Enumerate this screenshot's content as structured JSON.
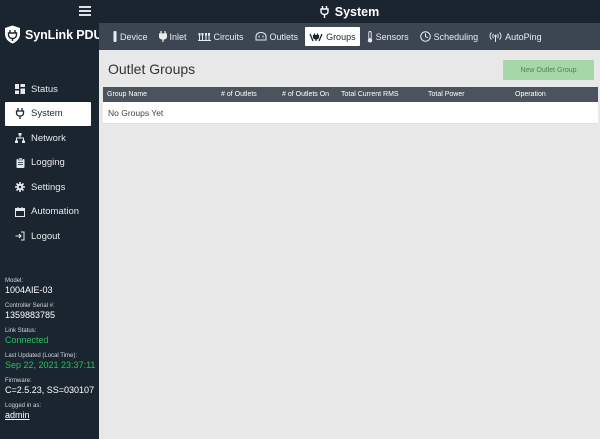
{
  "brand": {
    "name": "SynLink PDU"
  },
  "page": {
    "title": "System"
  },
  "sidebar": {
    "items": [
      {
        "label": "Status",
        "icon": "dashboard-icon"
      },
      {
        "label": "System",
        "icon": "plug-icon",
        "active": true
      },
      {
        "label": "Network",
        "icon": "network-icon"
      },
      {
        "label": "Logging",
        "icon": "clipboard-icon"
      },
      {
        "label": "Settings",
        "icon": "gear-icon"
      },
      {
        "label": "Automation",
        "icon": "calendar-icon"
      },
      {
        "label": "Logout",
        "icon": "logout-icon"
      }
    ]
  },
  "device_info": {
    "model_label": "Model:",
    "model": "1004AIE-03",
    "serial_label": "Controller Serial #:",
    "serial": "1359883785",
    "link_label": "Link Status:",
    "link": "Connected",
    "updated_label": "Last Updated (Local Time):",
    "updated": "Sep 22, 2021 23:37:11",
    "firmware_label": "Firmware:",
    "firmware": "C=2.5.23, SS=030107",
    "login_label": "Logged in as:",
    "user": "admin"
  },
  "tabs": [
    {
      "label": "Device",
      "icon": "device-icon"
    },
    {
      "label": "Inlet",
      "icon": "plug-icon"
    },
    {
      "label": "Circuits",
      "icon": "circuits-icon"
    },
    {
      "label": "Outlets",
      "icon": "outlet-icon"
    },
    {
      "label": "Groups",
      "icon": "groups-icon",
      "active": true
    },
    {
      "label": "Sensors",
      "icon": "thermometer-icon"
    },
    {
      "label": "Scheduling",
      "icon": "clock-icon"
    },
    {
      "label": "AutoPing",
      "icon": "broadcast-icon"
    }
  ],
  "content": {
    "heading": "Outlet Groups",
    "new_button": "New Outlet Group",
    "columns": [
      "Group Name",
      "# of Outlets",
      "# of Outlets On",
      "Total Current RMS",
      "Total Power",
      "Operation"
    ],
    "empty_text": "No Groups Yet"
  },
  "colors": {
    "sidebar_bg": "#1b2530",
    "tab_bar_bg": "#3c4652",
    "connected": "#22c35b",
    "button_bg": "#a6d7a8"
  }
}
